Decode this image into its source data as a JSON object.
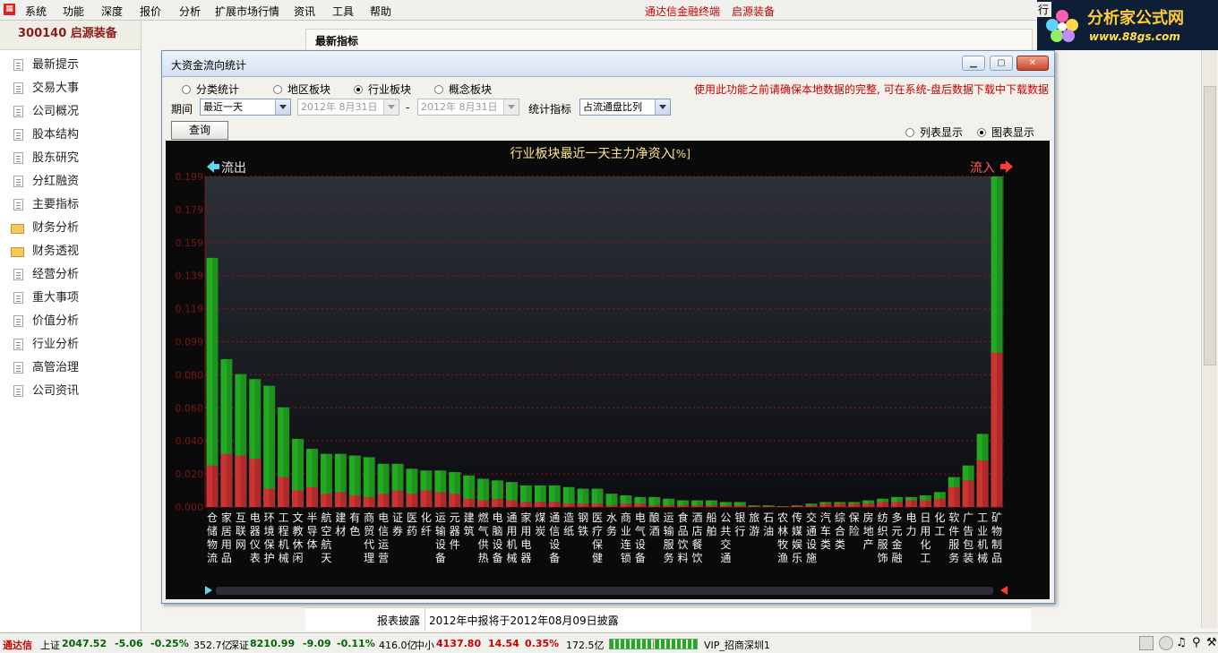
{
  "menu": {
    "items": [
      "系统",
      "功能",
      "深度",
      "报价",
      "分析",
      "扩展市场行情",
      "资讯",
      "工具",
      "帮助"
    ],
    "app_title": "通达信金融终端",
    "stock_title": "启源装备"
  },
  "brand": {
    "name": "分析家公式网",
    "url": "www.88gs.com",
    "partial_button": "行"
  },
  "left_panel": {
    "stock_header": "300140 启源装备",
    "items": [
      {
        "label": "最新提示",
        "icon": "document-icon"
      },
      {
        "label": "交易大事",
        "icon": "document-icon"
      },
      {
        "label": "公司概况",
        "icon": "document-icon"
      },
      {
        "label": "股本结构",
        "icon": "document-icon"
      },
      {
        "label": "股东研究",
        "icon": "document-icon"
      },
      {
        "label": "分红融资",
        "icon": "document-icon"
      },
      {
        "label": "主要指标",
        "icon": "document-icon"
      },
      {
        "label": "财务分析",
        "icon": "folder-icon"
      },
      {
        "label": "财务透视",
        "icon": "folder-icon"
      },
      {
        "label": "经营分析",
        "icon": "document-icon"
      },
      {
        "label": "重大事项",
        "icon": "document-icon"
      },
      {
        "label": "价值分析",
        "icon": "document-icon"
      },
      {
        "label": "行业分析",
        "icon": "document-icon"
      },
      {
        "label": "高管治理",
        "icon": "document-icon"
      },
      {
        "label": "公司资讯",
        "icon": "document-icon"
      }
    ]
  },
  "main": {
    "section_title": "最新指标",
    "report_label": "报表披露",
    "report_value": "2012年中报将于2012年08月09日披露"
  },
  "dialog": {
    "title": "大资金流向统计",
    "radios": [
      {
        "label": "分类统计",
        "checked": false
      },
      {
        "label": "地区板块",
        "checked": false
      },
      {
        "label": "行业板块",
        "checked": true
      },
      {
        "label": "概念板块",
        "checked": false
      }
    ],
    "warning": "使用此功能之前请确保本地数据的完整, 可在系统-盘后数据下载中下载数据",
    "period_label": "期间",
    "period_value": "最近一天",
    "date_from": "2012年 8月31日",
    "date_to": "2012年 8月31日",
    "date_sep": "-",
    "stat_label": "统计指标",
    "stat_value": "占流通盘比列",
    "query_button": "查询",
    "view_options": [
      {
        "label": "列表显示",
        "checked": false
      },
      {
        "label": "图表显示",
        "checked": true
      }
    ]
  },
  "chart_data": {
    "type": "bar",
    "title": "行业板块最近一天主力净资入",
    "title_unit": "[%]",
    "outflow_label": "流出",
    "inflow_label": "流入",
    "ylim": [
      0,
      0.199
    ],
    "yticks": [
      "0.199",
      "0.179",
      "0.159",
      "0.139",
      "0.119",
      "0.099",
      "0.080",
      "0.060",
      "0.040",
      "0.020",
      "0.000"
    ],
    "grid": true,
    "categories": [
      "仓储物流",
      "家居用品",
      "互联网",
      "电器仪表",
      "环境保护",
      "工程机械",
      "文教休闲",
      "半导体",
      "航空航天",
      "建材",
      "有色",
      "商贸代理",
      "电信运营",
      "证券",
      "医药",
      "化纤",
      "运输设备",
      "元器件",
      "建筑",
      "燃气供热",
      "电脑设备",
      "通用机械",
      "家用电器",
      "煤炭",
      "通信设备",
      "造纸",
      "钢铁",
      "医疗保健",
      "水务",
      "商业连锁",
      "电气设备",
      "酿酒",
      "运输服务",
      "食品饮料",
      "酒店餐饮",
      "船舶",
      "公共交通",
      "银行",
      "旅游",
      "石油",
      "农林牧渔",
      "传媒娱乐",
      "交通设施",
      "汽车类",
      "综合类",
      "保险",
      "房地产",
      "纺织服饰",
      "多元金融",
      "电力",
      "日用化工",
      "化工",
      "软件服务",
      "广告包装",
      "工业机械",
      "矿物制品"
    ],
    "side": [
      "out",
      "out",
      "out",
      "out",
      "out",
      "out",
      "out",
      "out",
      "out",
      "out",
      "out",
      "out",
      "out",
      "out",
      "out",
      "out",
      "out",
      "out",
      "out",
      "out",
      "out",
      "out",
      "out",
      "out",
      "out",
      "out",
      "out",
      "out",
      "out",
      "out",
      "out",
      "out",
      "out",
      "out",
      "out",
      "out",
      "out",
      "out",
      "out",
      "out",
      "in",
      "in",
      "in",
      "in",
      "in",
      "in",
      "in",
      "in",
      "in",
      "in",
      "in",
      "in",
      "in",
      "in",
      "in",
      "in"
    ],
    "total": [
      0.15,
      0.089,
      0.08,
      0.077,
      0.073,
      0.06,
      0.041,
      0.035,
      0.032,
      0.032,
      0.031,
      0.03,
      0.026,
      0.026,
      0.023,
      0.022,
      0.022,
      0.021,
      0.019,
      0.017,
      0.016,
      0.015,
      0.013,
      0.013,
      0.013,
      0.012,
      0.011,
      0.011,
      0.008,
      0.007,
      0.006,
      0.006,
      0.005,
      0.004,
      0.004,
      0.004,
      0.003,
      0.003,
      0.001,
      0.001,
      0.0005,
      0.001,
      0.002,
      0.003,
      0.003,
      0.003,
      0.004,
      0.005,
      0.006,
      0.006,
      0.007,
      0.009,
      0.018,
      0.025,
      0.044,
      0.199
    ],
    "red_part": [
      0.025,
      0.032,
      0.031,
      0.029,
      0.011,
      0.018,
      0.01,
      0.012,
      0.008,
      0.009,
      0.007,
      0.006,
      0.008,
      0.01,
      0.008,
      0.01,
      0.009,
      0.008,
      0.005,
      0.004,
      0.005,
      0.004,
      0.003,
      0.003,
      0.003,
      0.002,
      0.002,
      0.002,
      0.001,
      0.002,
      0.002,
      0.001,
      0.001,
      0.001,
      0.001,
      0.001,
      0.001,
      0.001,
      0.0005,
      0.0005,
      0.0003,
      0.0007,
      0.001,
      0.002,
      0.002,
      0.002,
      0.002,
      0.003,
      0.003,
      0.004,
      0.004,
      0.005,
      0.012,
      0.016,
      0.028,
      0.093
    ]
  },
  "status": {
    "app": "通达信",
    "sh_label": "上证",
    "sh_value": "2047.52",
    "sh_change": "-5.06",
    "sh_pct": "-0.25%",
    "sh_amount": "352.7亿",
    "sz_label": "深证",
    "sz_value": "8210.99",
    "sz_change": "-9.09",
    "sz_pct": "-0.11%",
    "sz_amount": "416.0亿",
    "zx_label": "中小",
    "zx_value": "4137.80",
    "zx_change": "14.54",
    "zx_pct": "0.35%",
    "zx_amount": "172.5亿",
    "server": "VIP_招商深圳1"
  },
  "colors": {
    "inflow": "#cc3333",
    "outflow": "#22aa22",
    "chart_bg": "#0a0a0a",
    "grid": "#8a1a1a",
    "title": "#ffe68a"
  }
}
